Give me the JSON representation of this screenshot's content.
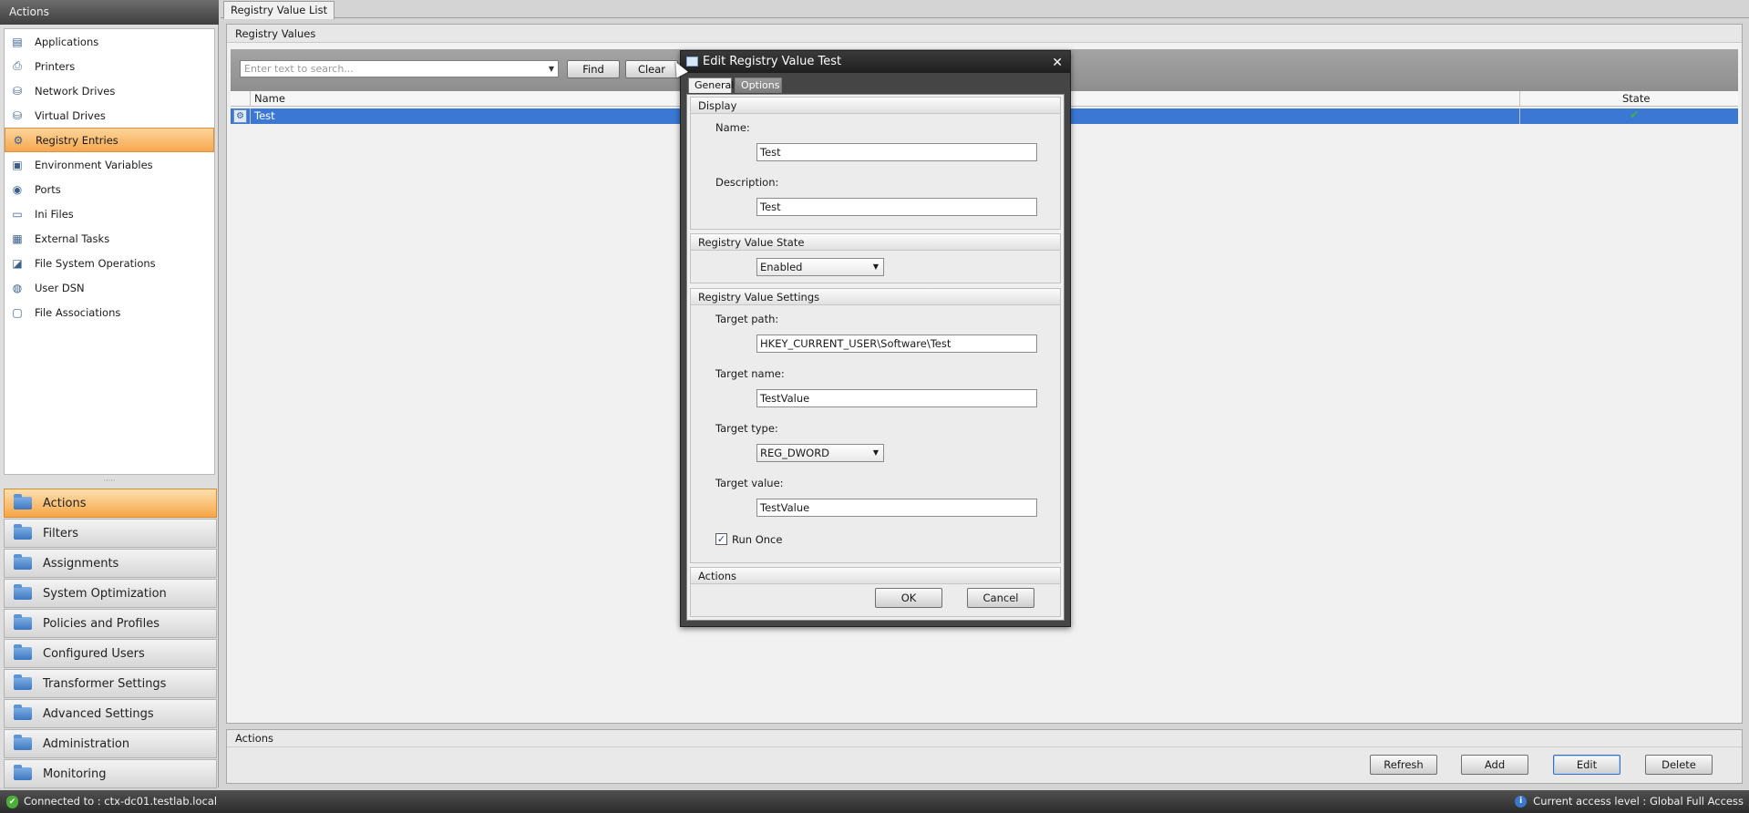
{
  "sidebar": {
    "header": "Actions",
    "items": [
      {
        "label": "Applications",
        "icon": "applications-icon",
        "glyph": "▤"
      },
      {
        "label": "Printers",
        "icon": "printer-icon",
        "glyph": "⎙"
      },
      {
        "label": "Network Drives",
        "icon": "network-drive-icon",
        "glyph": "⛁"
      },
      {
        "label": "Virtual Drives",
        "icon": "virtual-drive-icon",
        "glyph": "⛁"
      },
      {
        "label": "Registry Entries",
        "icon": "registry-icon",
        "glyph": "⚙",
        "selected": true
      },
      {
        "label": "Environment Variables",
        "icon": "environment-variables-icon",
        "glyph": "▣"
      },
      {
        "label": "Ports",
        "icon": "ports-icon",
        "glyph": "◉"
      },
      {
        "label": "Ini Files",
        "icon": "ini-file-icon",
        "glyph": "▭"
      },
      {
        "label": "External Tasks",
        "icon": "external-tasks-icon",
        "glyph": "▦"
      },
      {
        "label": "File System Operations",
        "icon": "file-system-icon",
        "glyph": "◪"
      },
      {
        "label": "User DSN",
        "icon": "user-dsn-icon",
        "glyph": "◍"
      },
      {
        "label": "File Associations",
        "icon": "file-associations-icon",
        "glyph": "▢"
      }
    ],
    "splitter_glyph": "·····",
    "groups": [
      {
        "label": "Actions",
        "selected": true
      },
      {
        "label": "Filters"
      },
      {
        "label": "Assignments"
      },
      {
        "label": "System Optimization"
      },
      {
        "label": "Policies and Profiles"
      },
      {
        "label": "Configured Users"
      },
      {
        "label": "Transformer Settings"
      },
      {
        "label": "Advanced Settings"
      },
      {
        "label": "Administration"
      },
      {
        "label": "Monitoring"
      }
    ]
  },
  "main": {
    "tab": "Registry Value List",
    "panel_title": "Registry Values",
    "search": {
      "placeholder": "Enter text to search...",
      "find": "Find",
      "clear": "Clear",
      "dropdown_glyph": "▼"
    },
    "grid": {
      "columns": {
        "name": "Name",
        "state": "State"
      },
      "rows": [
        {
          "name": "Test",
          "state_icon": "check-icon",
          "state_glyph": "✔"
        }
      ]
    },
    "actions_title": "Actions",
    "buttons": {
      "refresh": "Refresh",
      "add": "Add",
      "edit": "Edit",
      "delete": "Delete"
    }
  },
  "status": {
    "connected": "Connected to : ctx-dc01.testlab.local",
    "access": "Current access level  : Global Full Access",
    "shield_glyph": "✔",
    "info_glyph": "i"
  },
  "dialog": {
    "title": "Edit Registry Value Test",
    "close_glyph": "✕",
    "tabs": {
      "general": "General",
      "options": "Options"
    },
    "display": {
      "title": "Display",
      "name_label": "Name:",
      "name_value": "Test",
      "desc_label": "Description:",
      "desc_value": "Test"
    },
    "state": {
      "title": "Registry Value State",
      "value": "Enabled",
      "arrow": "▼"
    },
    "settings": {
      "title": "Registry Value Settings",
      "path_label": "Target path:",
      "path_value": "HKEY_CURRENT_USER\\Software\\Test",
      "name_label": "Target name:",
      "name_value": "TestValue",
      "type_label": "Target type:",
      "type_value": "REG_DWORD",
      "value_label": "Target value:",
      "value_value": "TestValue",
      "run_once_label": "Run Once",
      "run_once_checked": true,
      "check_glyph": "✓"
    },
    "actions": {
      "title": "Actions",
      "ok": "OK",
      "cancel": "Cancel"
    }
  },
  "colors": {
    "accent_orange": "#f6a750",
    "selection_blue": "#3a78d4",
    "state_green": "#3cb043"
  }
}
